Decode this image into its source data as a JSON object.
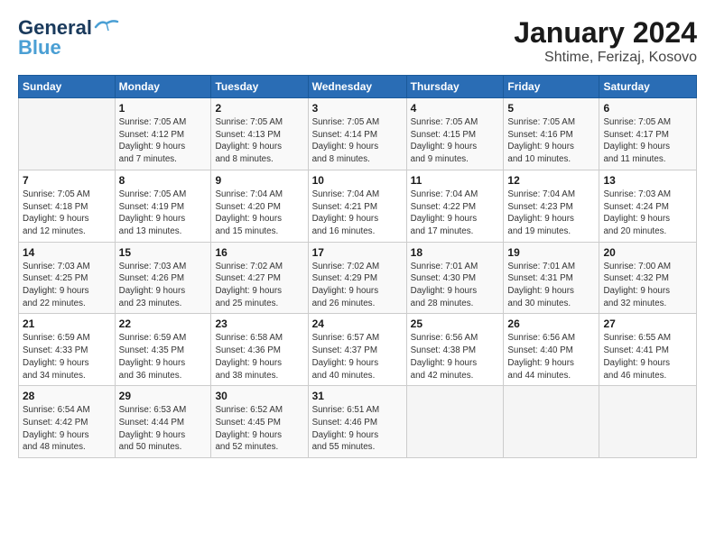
{
  "logo": {
    "line1": "General",
    "line2": "Blue"
  },
  "title": "January 2024",
  "subtitle": "Shtime, Ferizaj, Kosovo",
  "header_colors": {
    "bg": "#2a6db5"
  },
  "days_of_week": [
    "Sunday",
    "Monday",
    "Tuesday",
    "Wednesday",
    "Thursday",
    "Friday",
    "Saturday"
  ],
  "weeks": [
    [
      {
        "day": "",
        "info": ""
      },
      {
        "day": "1",
        "info": "Sunrise: 7:05 AM\nSunset: 4:12 PM\nDaylight: 9 hours\nand 7 minutes."
      },
      {
        "day": "2",
        "info": "Sunrise: 7:05 AM\nSunset: 4:13 PM\nDaylight: 9 hours\nand 8 minutes."
      },
      {
        "day": "3",
        "info": "Sunrise: 7:05 AM\nSunset: 4:14 PM\nDaylight: 9 hours\nand 8 minutes."
      },
      {
        "day": "4",
        "info": "Sunrise: 7:05 AM\nSunset: 4:15 PM\nDaylight: 9 hours\nand 9 minutes."
      },
      {
        "day": "5",
        "info": "Sunrise: 7:05 AM\nSunset: 4:16 PM\nDaylight: 9 hours\nand 10 minutes."
      },
      {
        "day": "6",
        "info": "Sunrise: 7:05 AM\nSunset: 4:17 PM\nDaylight: 9 hours\nand 11 minutes."
      }
    ],
    [
      {
        "day": "7",
        "info": "Sunrise: 7:05 AM\nSunset: 4:18 PM\nDaylight: 9 hours\nand 12 minutes."
      },
      {
        "day": "8",
        "info": "Sunrise: 7:05 AM\nSunset: 4:19 PM\nDaylight: 9 hours\nand 13 minutes."
      },
      {
        "day": "9",
        "info": "Sunrise: 7:04 AM\nSunset: 4:20 PM\nDaylight: 9 hours\nand 15 minutes."
      },
      {
        "day": "10",
        "info": "Sunrise: 7:04 AM\nSunset: 4:21 PM\nDaylight: 9 hours\nand 16 minutes."
      },
      {
        "day": "11",
        "info": "Sunrise: 7:04 AM\nSunset: 4:22 PM\nDaylight: 9 hours\nand 17 minutes."
      },
      {
        "day": "12",
        "info": "Sunrise: 7:04 AM\nSunset: 4:23 PM\nDaylight: 9 hours\nand 19 minutes."
      },
      {
        "day": "13",
        "info": "Sunrise: 7:03 AM\nSunset: 4:24 PM\nDaylight: 9 hours\nand 20 minutes."
      }
    ],
    [
      {
        "day": "14",
        "info": "Sunrise: 7:03 AM\nSunset: 4:25 PM\nDaylight: 9 hours\nand 22 minutes."
      },
      {
        "day": "15",
        "info": "Sunrise: 7:03 AM\nSunset: 4:26 PM\nDaylight: 9 hours\nand 23 minutes."
      },
      {
        "day": "16",
        "info": "Sunrise: 7:02 AM\nSunset: 4:27 PM\nDaylight: 9 hours\nand 25 minutes."
      },
      {
        "day": "17",
        "info": "Sunrise: 7:02 AM\nSunset: 4:29 PM\nDaylight: 9 hours\nand 26 minutes."
      },
      {
        "day": "18",
        "info": "Sunrise: 7:01 AM\nSunset: 4:30 PM\nDaylight: 9 hours\nand 28 minutes."
      },
      {
        "day": "19",
        "info": "Sunrise: 7:01 AM\nSunset: 4:31 PM\nDaylight: 9 hours\nand 30 minutes."
      },
      {
        "day": "20",
        "info": "Sunrise: 7:00 AM\nSunset: 4:32 PM\nDaylight: 9 hours\nand 32 minutes."
      }
    ],
    [
      {
        "day": "21",
        "info": "Sunrise: 6:59 AM\nSunset: 4:33 PM\nDaylight: 9 hours\nand 34 minutes."
      },
      {
        "day": "22",
        "info": "Sunrise: 6:59 AM\nSunset: 4:35 PM\nDaylight: 9 hours\nand 36 minutes."
      },
      {
        "day": "23",
        "info": "Sunrise: 6:58 AM\nSunset: 4:36 PM\nDaylight: 9 hours\nand 38 minutes."
      },
      {
        "day": "24",
        "info": "Sunrise: 6:57 AM\nSunset: 4:37 PM\nDaylight: 9 hours\nand 40 minutes."
      },
      {
        "day": "25",
        "info": "Sunrise: 6:56 AM\nSunset: 4:38 PM\nDaylight: 9 hours\nand 42 minutes."
      },
      {
        "day": "26",
        "info": "Sunrise: 6:56 AM\nSunset: 4:40 PM\nDaylight: 9 hours\nand 44 minutes."
      },
      {
        "day": "27",
        "info": "Sunrise: 6:55 AM\nSunset: 4:41 PM\nDaylight: 9 hours\nand 46 minutes."
      }
    ],
    [
      {
        "day": "28",
        "info": "Sunrise: 6:54 AM\nSunset: 4:42 PM\nDaylight: 9 hours\nand 48 minutes."
      },
      {
        "day": "29",
        "info": "Sunrise: 6:53 AM\nSunset: 4:44 PM\nDaylight: 9 hours\nand 50 minutes."
      },
      {
        "day": "30",
        "info": "Sunrise: 6:52 AM\nSunset: 4:45 PM\nDaylight: 9 hours\nand 52 minutes."
      },
      {
        "day": "31",
        "info": "Sunrise: 6:51 AM\nSunset: 4:46 PM\nDaylight: 9 hours\nand 55 minutes."
      },
      {
        "day": "",
        "info": ""
      },
      {
        "day": "",
        "info": ""
      },
      {
        "day": "",
        "info": ""
      }
    ]
  ]
}
